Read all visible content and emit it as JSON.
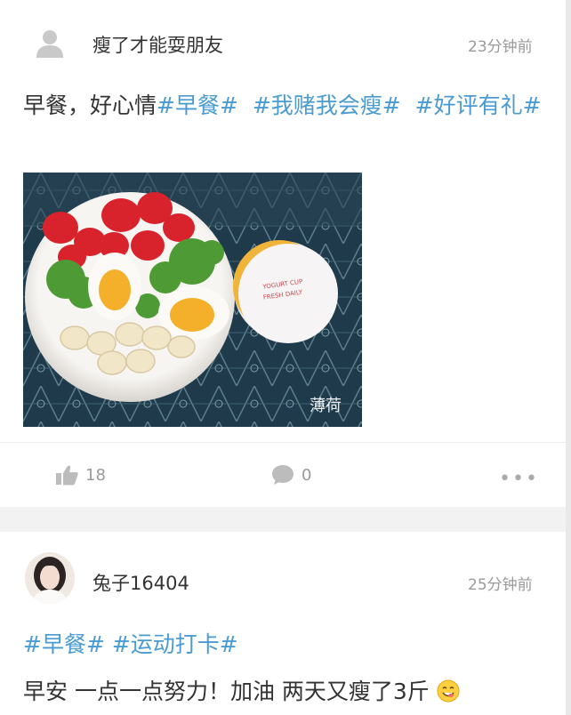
{
  "post1": {
    "username": "瘦了才能耍朋友",
    "time": "23分钟前",
    "text_plain": "早餐，好心情",
    "tags": [
      "#早餐#",
      "#我赌我会瘦#",
      "#好评有礼#"
    ],
    "photo_watermark": "薄荷",
    "likes": "18",
    "comments": "0"
  },
  "post2": {
    "username": "兔子16404",
    "time": "25分钟前",
    "tags": [
      "#早餐#",
      "#运动打卡#"
    ],
    "text_plain": "早安 一点一点努力！加油 两天又瘦了3斤"
  },
  "icons": {
    "like": "thumbs-up-icon",
    "comment": "comment-bubble-icon",
    "more": "more-dots-icon",
    "avatar_default": "default-user-avatar-icon",
    "emoji": "smiling-face-emoji"
  },
  "colors": {
    "tag": "#4a9bd1",
    "muted": "#9a9a9a",
    "background": "#f2f2f2"
  }
}
